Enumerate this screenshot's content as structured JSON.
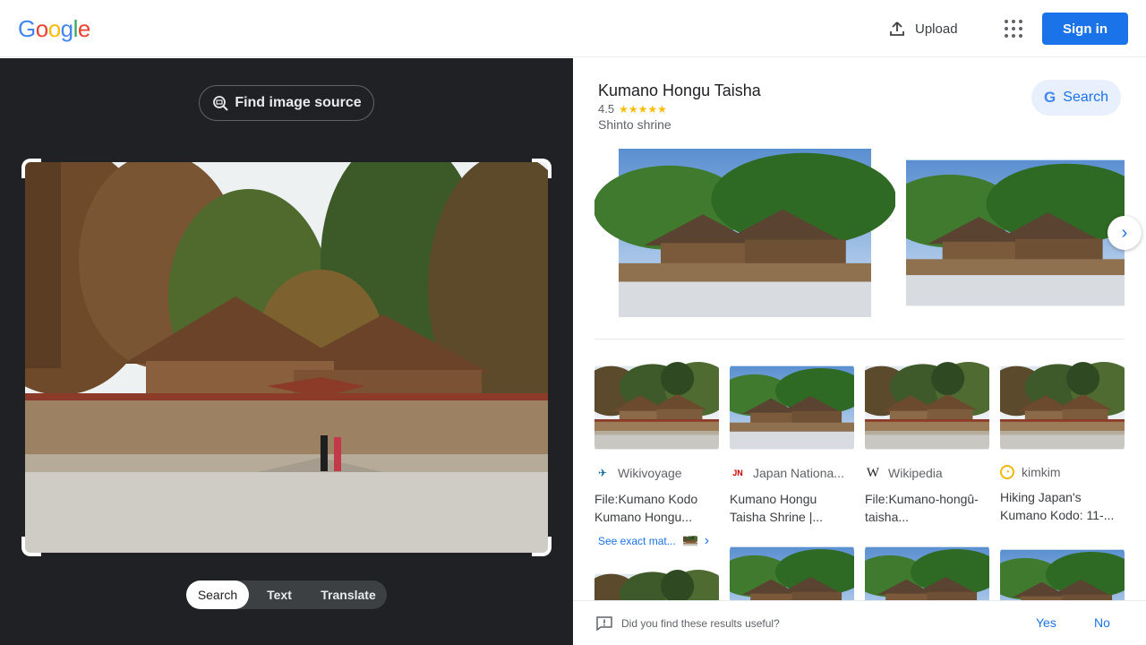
{
  "header": {
    "logo_letters": [
      "G",
      "o",
      "o",
      "g",
      "l",
      "e"
    ],
    "logo_colors": [
      "#4285f4",
      "#ea4335",
      "#fbbc05",
      "#4285f4",
      "#34a853",
      "#ea4335"
    ],
    "upload_label": "Upload",
    "apps_icon": "apps-grid-icon",
    "signin_label": "Sign in"
  },
  "left": {
    "find_source_label": "Find image source",
    "modes": [
      "Search",
      "Text",
      "Translate"
    ],
    "active_mode": "Search"
  },
  "knowledge": {
    "title": "Kumano Hongu Taisha",
    "rating": "4.5",
    "stars": "★★★★★",
    "type": "Shinto shrine",
    "search_label": "Search"
  },
  "results": [
    {
      "source": "Wikivoyage",
      "title": "File:Kumano Kodo Kumano Hongu..."
    },
    {
      "source": "Japan Nationa...",
      "title": "Kumano Hongu Taisha Shrine |..."
    },
    {
      "source": "Wikipedia",
      "title": "File:Kumano-hongû-taisha..."
    },
    {
      "source": "kimkim",
      "title": "Hiking Japan's Kumano Kodo: 11-..."
    }
  ],
  "see_exact": "See exact mat...",
  "feedback": {
    "question": "Did you find these results useful?",
    "yes": "Yes",
    "no": "No"
  },
  "colors": {
    "accent": "#1a73e8",
    "dark_panel": "#202124",
    "star": "#fbbc04"
  }
}
